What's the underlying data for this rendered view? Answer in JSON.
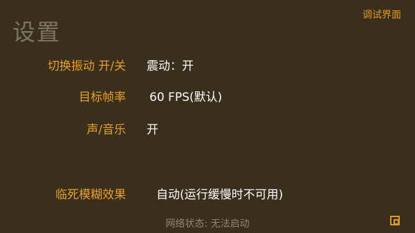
{
  "header": {
    "title": "设置",
    "debug_link": "调试界面"
  },
  "settings": [
    {
      "label": "切换振动 开/关",
      "value": "震动：开"
    },
    {
      "label": "目标帧率",
      "value": "60 FPS(默认)"
    },
    {
      "label": "声/音乐",
      "value": "开"
    },
    {
      "label": "临死模糊效果",
      "value": "自动(运行缓慢时不可用)"
    }
  ],
  "footer": {
    "network_status": "网络状态: 无法启动",
    "back_icon": "square-back-icon"
  },
  "colors": {
    "background": "#3a2e1c",
    "accent": "#e8a020",
    "title": "#7d7663",
    "value_text": "#ffffff",
    "status_text": "#8e8776"
  }
}
